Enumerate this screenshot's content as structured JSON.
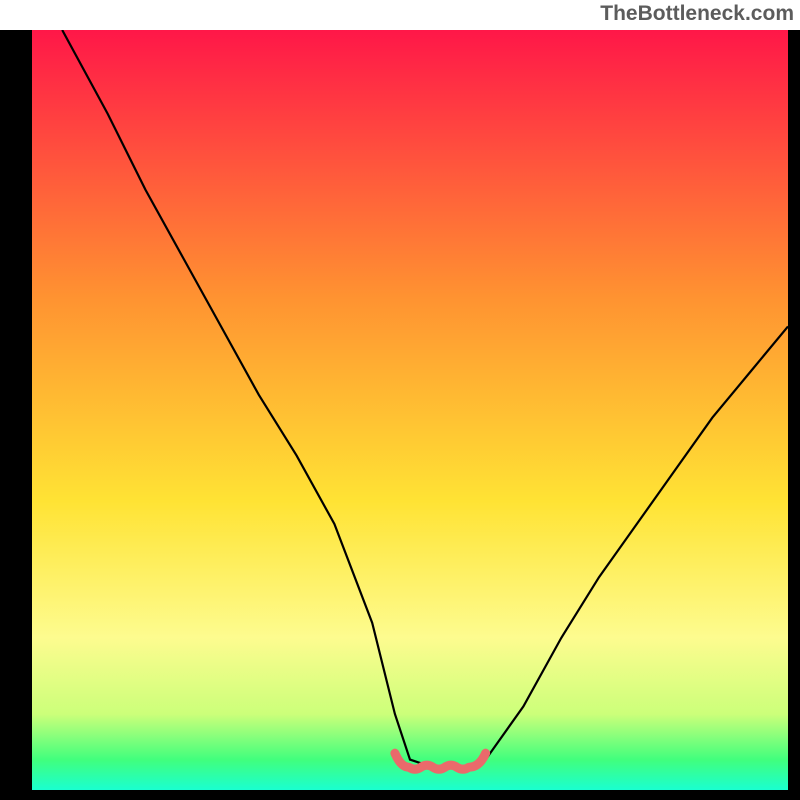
{
  "watermark": "TheBottleneck.com",
  "chart_data": {
    "type": "line",
    "title": "",
    "xlabel": "",
    "ylabel": "",
    "xlim": [
      0,
      100
    ],
    "ylim": [
      0,
      100
    ],
    "x": [
      4,
      10,
      15,
      20,
      25,
      30,
      35,
      40,
      45,
      48,
      50,
      53,
      55,
      57,
      60,
      65,
      70,
      75,
      80,
      85,
      90,
      95,
      100
    ],
    "values": [
      100,
      89,
      79,
      70,
      61,
      52,
      44,
      35,
      22,
      10,
      4,
      3,
      3,
      3,
      4,
      11,
      20,
      28,
      35,
      42,
      49,
      55,
      61
    ],
    "background": {
      "type": "gradient",
      "stops": [
        {
          "pos": 0.0,
          "color": "#ff1748"
        },
        {
          "pos": 0.35,
          "color": "#ff9231"
        },
        {
          "pos": 0.62,
          "color": "#ffe334"
        },
        {
          "pos": 0.8,
          "color": "#fdfc8f"
        },
        {
          "pos": 0.9,
          "color": "#ccff7a"
        },
        {
          "pos": 0.96,
          "color": "#41ff7d"
        },
        {
          "pos": 1.0,
          "color": "#1affd0"
        }
      ]
    },
    "dip_marker": {
      "color": "#ea6a6b",
      "x_from": 48,
      "x_to": 60,
      "y": 3
    }
  }
}
